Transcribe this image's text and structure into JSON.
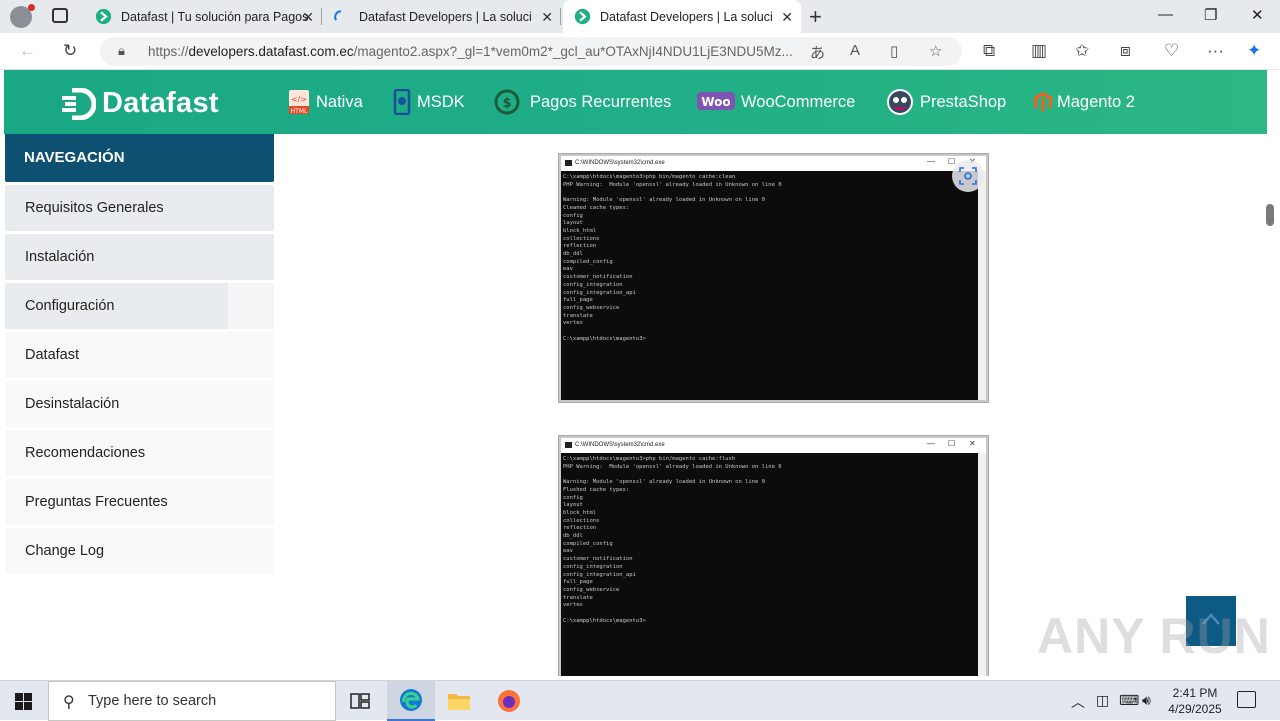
{
  "browser": {
    "tabs": [
      {
        "title": "Datafast | Tu solución para Pagos",
        "active": false
      },
      {
        "title": "Datafast Developers | La solución",
        "active": false
      },
      {
        "title": "Datafast Developers | La solución",
        "active": true
      }
    ],
    "url_prefix": "https://",
    "url_domain": "developers.datafast.com.ec",
    "url_path": "/magento2.aspx?_gl=1*vem0m2*_gcl_au*OTAxNjI4NDU1LjE3NDU5Mz..."
  },
  "site": {
    "logo_text": "Datafast",
    "nav": [
      {
        "label": "Nativa",
        "icon": "html-icon"
      },
      {
        "label": "MSDK",
        "icon": "mobile-sdk-icon"
      },
      {
        "label": "Pagos Recurrentes",
        "icon": "recurring-payments-icon"
      },
      {
        "label": "WooCommerce",
        "icon": "woocommerce-icon"
      },
      {
        "label": "PrestaShop",
        "icon": "prestashop-icon"
      },
      {
        "label": "Magento 2",
        "icon": "magento-icon"
      }
    ]
  },
  "sidebar": {
    "heading": "NAVEGACIÓN",
    "items": [
      {
        "label": "Requisitos Generales"
      },
      {
        "label": "Instalación"
      },
      {
        "label": "Configuración"
      },
      {
        "label": "Datafast"
      },
      {
        "label": "Desinstalación"
      },
      {
        "label": "Recomendaciones"
      },
      {
        "label": "Preguntas Frecuentes"
      },
      {
        "label": "Change Log"
      }
    ]
  },
  "screenshots": [
    {
      "title": "C:\\WINDOWS\\system32\\cmd.exe",
      "lines": "C:\\xampp\\htdocs\\magento3>php bin/magento cache:clean\nPHP Warning:  Module 'openssl' already loaded in Unknown on line 0\n\nWarning: Module 'openssl' already loaded in Unknown on line 0\nCleaned cache types:\nconfig\nlayout\nblock_html\ncollections\nreflection\ndb_ddl\ncompiled_config\neav\ncustomer_notification\nconfig_integration\nconfig_integration_api\nfull_page\nconfig_webservice\ntranslate\nvertex\n\nC:\\xampp\\htdocs\\magento3>"
    },
    {
      "title": "C:\\WINDOWS\\system32\\cmd.exe",
      "lines": "C:\\xampp\\htdocs\\magento3>php bin/magento cache:flush\nPHP Warning:  Module 'openssl' already loaded in Unknown on line 0\n\nWarning: Module 'openssl' already loaded in Unknown on line 0\nFlushed cache types:\nconfig\nlayout\nblock_html\ncollections\nreflection\ndb_ddl\ncompiled_config\neav\ncustomer_notification\nconfig_integration\nconfig_integration_api\nfull_page\nconfig_webservice\ntranslate\nvertex\n\nC:\\xampp\\htdocs\\magento3>"
    }
  ],
  "watermark": "ANY RUN",
  "taskbar": {
    "search_placeholder": "Type here to search",
    "time": "2:41 PM",
    "date": "4/29/2025"
  },
  "colors": {
    "brand_green": "#1fae86",
    "nav_heading": "#0d5071",
    "to_top_button": "#0d5a85"
  }
}
